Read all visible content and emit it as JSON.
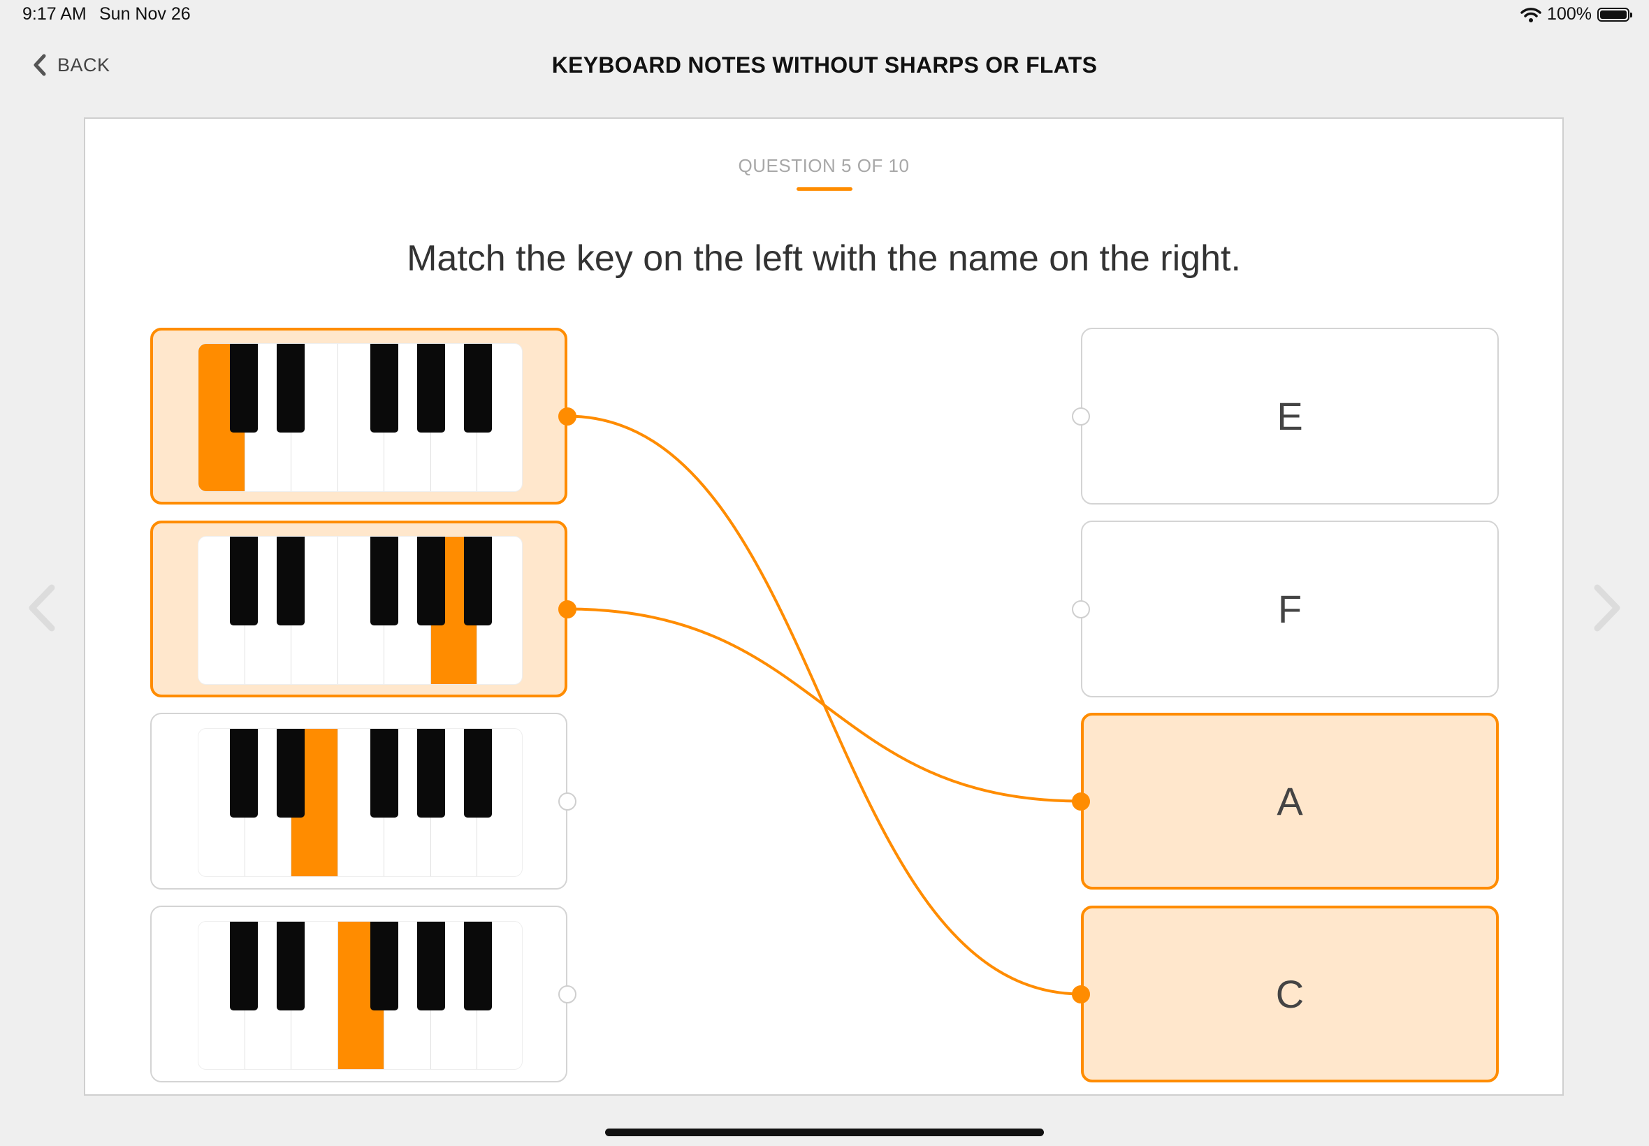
{
  "status": {
    "time": "9:17 AM",
    "date": "Sun Nov 26",
    "battery": "100%"
  },
  "header": {
    "back_label": "BACK",
    "title": "KEYBOARD NOTES WITHOUT SHARPS OR FLATS"
  },
  "quiz": {
    "counter": "QUESTION 5 OF 10",
    "prompt": "Match the key on the left with the name on the right.",
    "keys": [
      {
        "highlighted_white_key_index": 0,
        "selected": true
      },
      {
        "highlighted_white_key_index": 5,
        "selected": true
      },
      {
        "highlighted_white_key_index": 2,
        "selected": false
      },
      {
        "highlighted_white_key_index": 3,
        "selected": false
      }
    ],
    "names": [
      {
        "label": "E",
        "selected": false
      },
      {
        "label": "F",
        "selected": false
      },
      {
        "label": "A",
        "selected": true
      },
      {
        "label": "C",
        "selected": true
      }
    ],
    "matches": [
      {
        "key_index": 0,
        "name_index": 3
      },
      {
        "key_index": 1,
        "name_index": 2
      }
    ]
  },
  "colors": {
    "accent": "#ff8c00",
    "selected_fill": "#ffe7cc"
  },
  "icons": {
    "back": "chevron-left-icon",
    "prev": "chevron-left-icon",
    "next": "chevron-right-icon",
    "wifi": "wifi-icon",
    "battery": "battery-icon"
  }
}
